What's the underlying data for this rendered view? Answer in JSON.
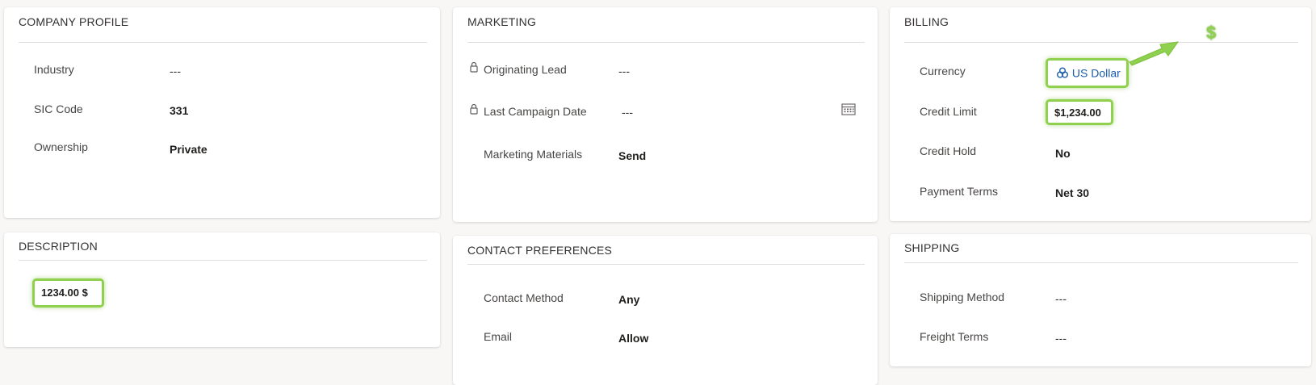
{
  "company_profile": {
    "title": "COMPANY PROFILE",
    "fields": [
      {
        "label": "Industry",
        "value": "---"
      },
      {
        "label": "SIC Code",
        "value": "331"
      },
      {
        "label": "Ownership",
        "value": "Private"
      }
    ]
  },
  "marketing": {
    "title": "MARKETING",
    "fields": [
      {
        "label": "Originating Lead",
        "value": "---"
      },
      {
        "label": "Last Campaign Date",
        "value": "---"
      },
      {
        "label": "Marketing Materials",
        "value": "Send"
      }
    ]
  },
  "billing": {
    "title": "BILLING",
    "fields": [
      {
        "label": "Currency",
        "value": "US Dollar"
      },
      {
        "label": "Credit Limit",
        "value": "$1,234.00"
      },
      {
        "label": "Credit Hold",
        "value": "No"
      },
      {
        "label": "Payment Terms",
        "value": "Net 30"
      }
    ],
    "annotation_symbol": "$"
  },
  "description": {
    "title": "DESCRIPTION",
    "value": "1234.00 $"
  },
  "contact_preferences": {
    "title": "CONTACT PREFERENCES",
    "fields": [
      {
        "label": "Contact Method",
        "value": "Any"
      },
      {
        "label": "Email",
        "value": "Allow"
      }
    ]
  },
  "shipping": {
    "title": "SHIPPING",
    "fields": [
      {
        "label": "Shipping Method",
        "value": "---"
      },
      {
        "label": "Freight Terms",
        "value": "---"
      }
    ]
  },
  "colors": {
    "highlight": "#8fd14f",
    "link": "#1a5dab"
  }
}
